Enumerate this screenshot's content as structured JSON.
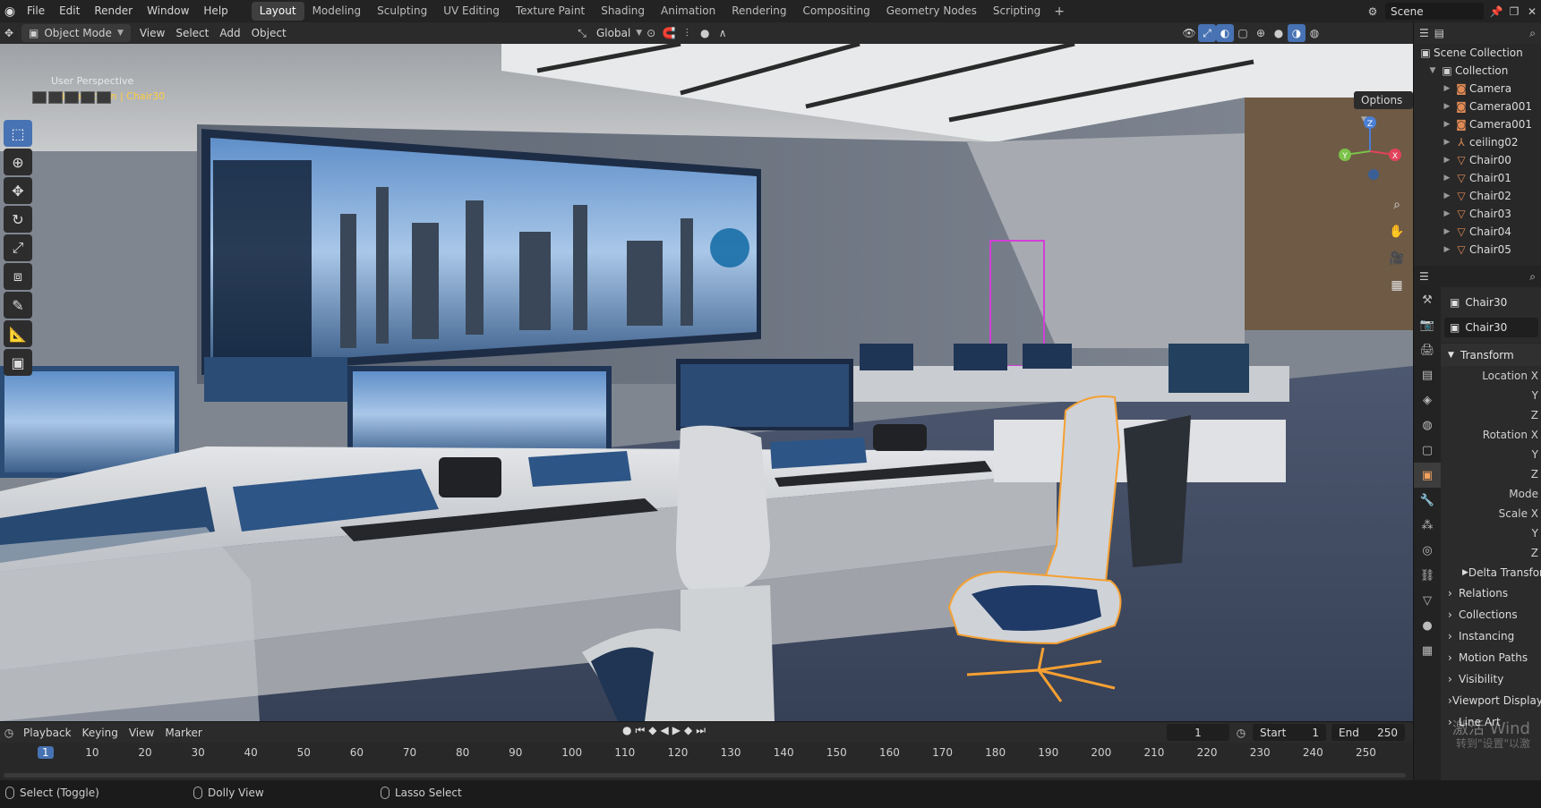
{
  "topbar": {
    "menus": [
      "File",
      "Edit",
      "Render",
      "Window",
      "Help"
    ],
    "workspaces": [
      "Layout",
      "Modeling",
      "Sculpting",
      "UV Editing",
      "Texture Paint",
      "Shading",
      "Animation",
      "Rendering",
      "Compositing",
      "Geometry Nodes",
      "Scripting"
    ],
    "active_workspace": "Layout",
    "scene_name": "Scene"
  },
  "header": {
    "mode": "Object Mode",
    "menus": [
      "View",
      "Select",
      "Add",
      "Object"
    ],
    "transform_orientation": "Global",
    "options_label": "Options"
  },
  "viewport": {
    "perspective_label": "User Perspective",
    "collection_label": "(1) Collection | Chair30",
    "gizmo_axes": [
      "X",
      "Y",
      "Z"
    ]
  },
  "outliner": {
    "scene_collection": "Scene Collection",
    "collection": "Collection",
    "items": [
      {
        "name": "Camera",
        "icon": "camera-icon"
      },
      {
        "name": "Camera001",
        "icon": "camera-icon"
      },
      {
        "name": "Camera001",
        "icon": "camera-icon"
      },
      {
        "name": "ceiling02",
        "icon": "armature-icon"
      },
      {
        "name": "Chair00",
        "icon": "mesh-icon"
      },
      {
        "name": "Chair01",
        "icon": "mesh-icon"
      },
      {
        "name": "Chair02",
        "icon": "mesh-icon"
      },
      {
        "name": "Chair03",
        "icon": "mesh-icon"
      },
      {
        "name": "Chair04",
        "icon": "mesh-icon"
      },
      {
        "name": "Chair05",
        "icon": "mesh-icon"
      }
    ]
  },
  "properties": {
    "object_name": "Chair30",
    "data_name": "Chair30",
    "transform_label": "Transform",
    "location_label": "Location X",
    "y_label": "Y",
    "z_label": "Z",
    "rotation_label": "Rotation X",
    "mode_label": "Mode",
    "scale_label": "Scale X",
    "delta_label": "Delta Transfor",
    "panels": [
      "Relations",
      "Collections",
      "Instancing",
      "Motion Paths",
      "Visibility",
      "Viewport Display",
      "Line Art"
    ]
  },
  "timeline": {
    "menus": [
      "Playback",
      "Keying",
      "View",
      "Marker"
    ],
    "current_frame": "1",
    "start_label": "Start",
    "start_value": "1",
    "end_label": "End",
    "end_value": "250",
    "ticks": [
      "1",
      "10",
      "20",
      "30",
      "40",
      "50",
      "60",
      "70",
      "80",
      "90",
      "100",
      "110",
      "120",
      "130",
      "140",
      "150",
      "160",
      "170",
      "180",
      "190",
      "200",
      "210",
      "220",
      "230",
      "240",
      "250"
    ]
  },
  "statusbar": {
    "hint1": "Select (Toggle)",
    "hint2": "Dolly View",
    "hint3": "Lasso Select"
  },
  "watermark": {
    "line1": "激活 Wind",
    "line2": "转到\"设置\"以激"
  },
  "colors": {
    "selection_orange": "#f5a033",
    "active_blue": "#4772b3",
    "collection_label": "#ffcc40"
  }
}
